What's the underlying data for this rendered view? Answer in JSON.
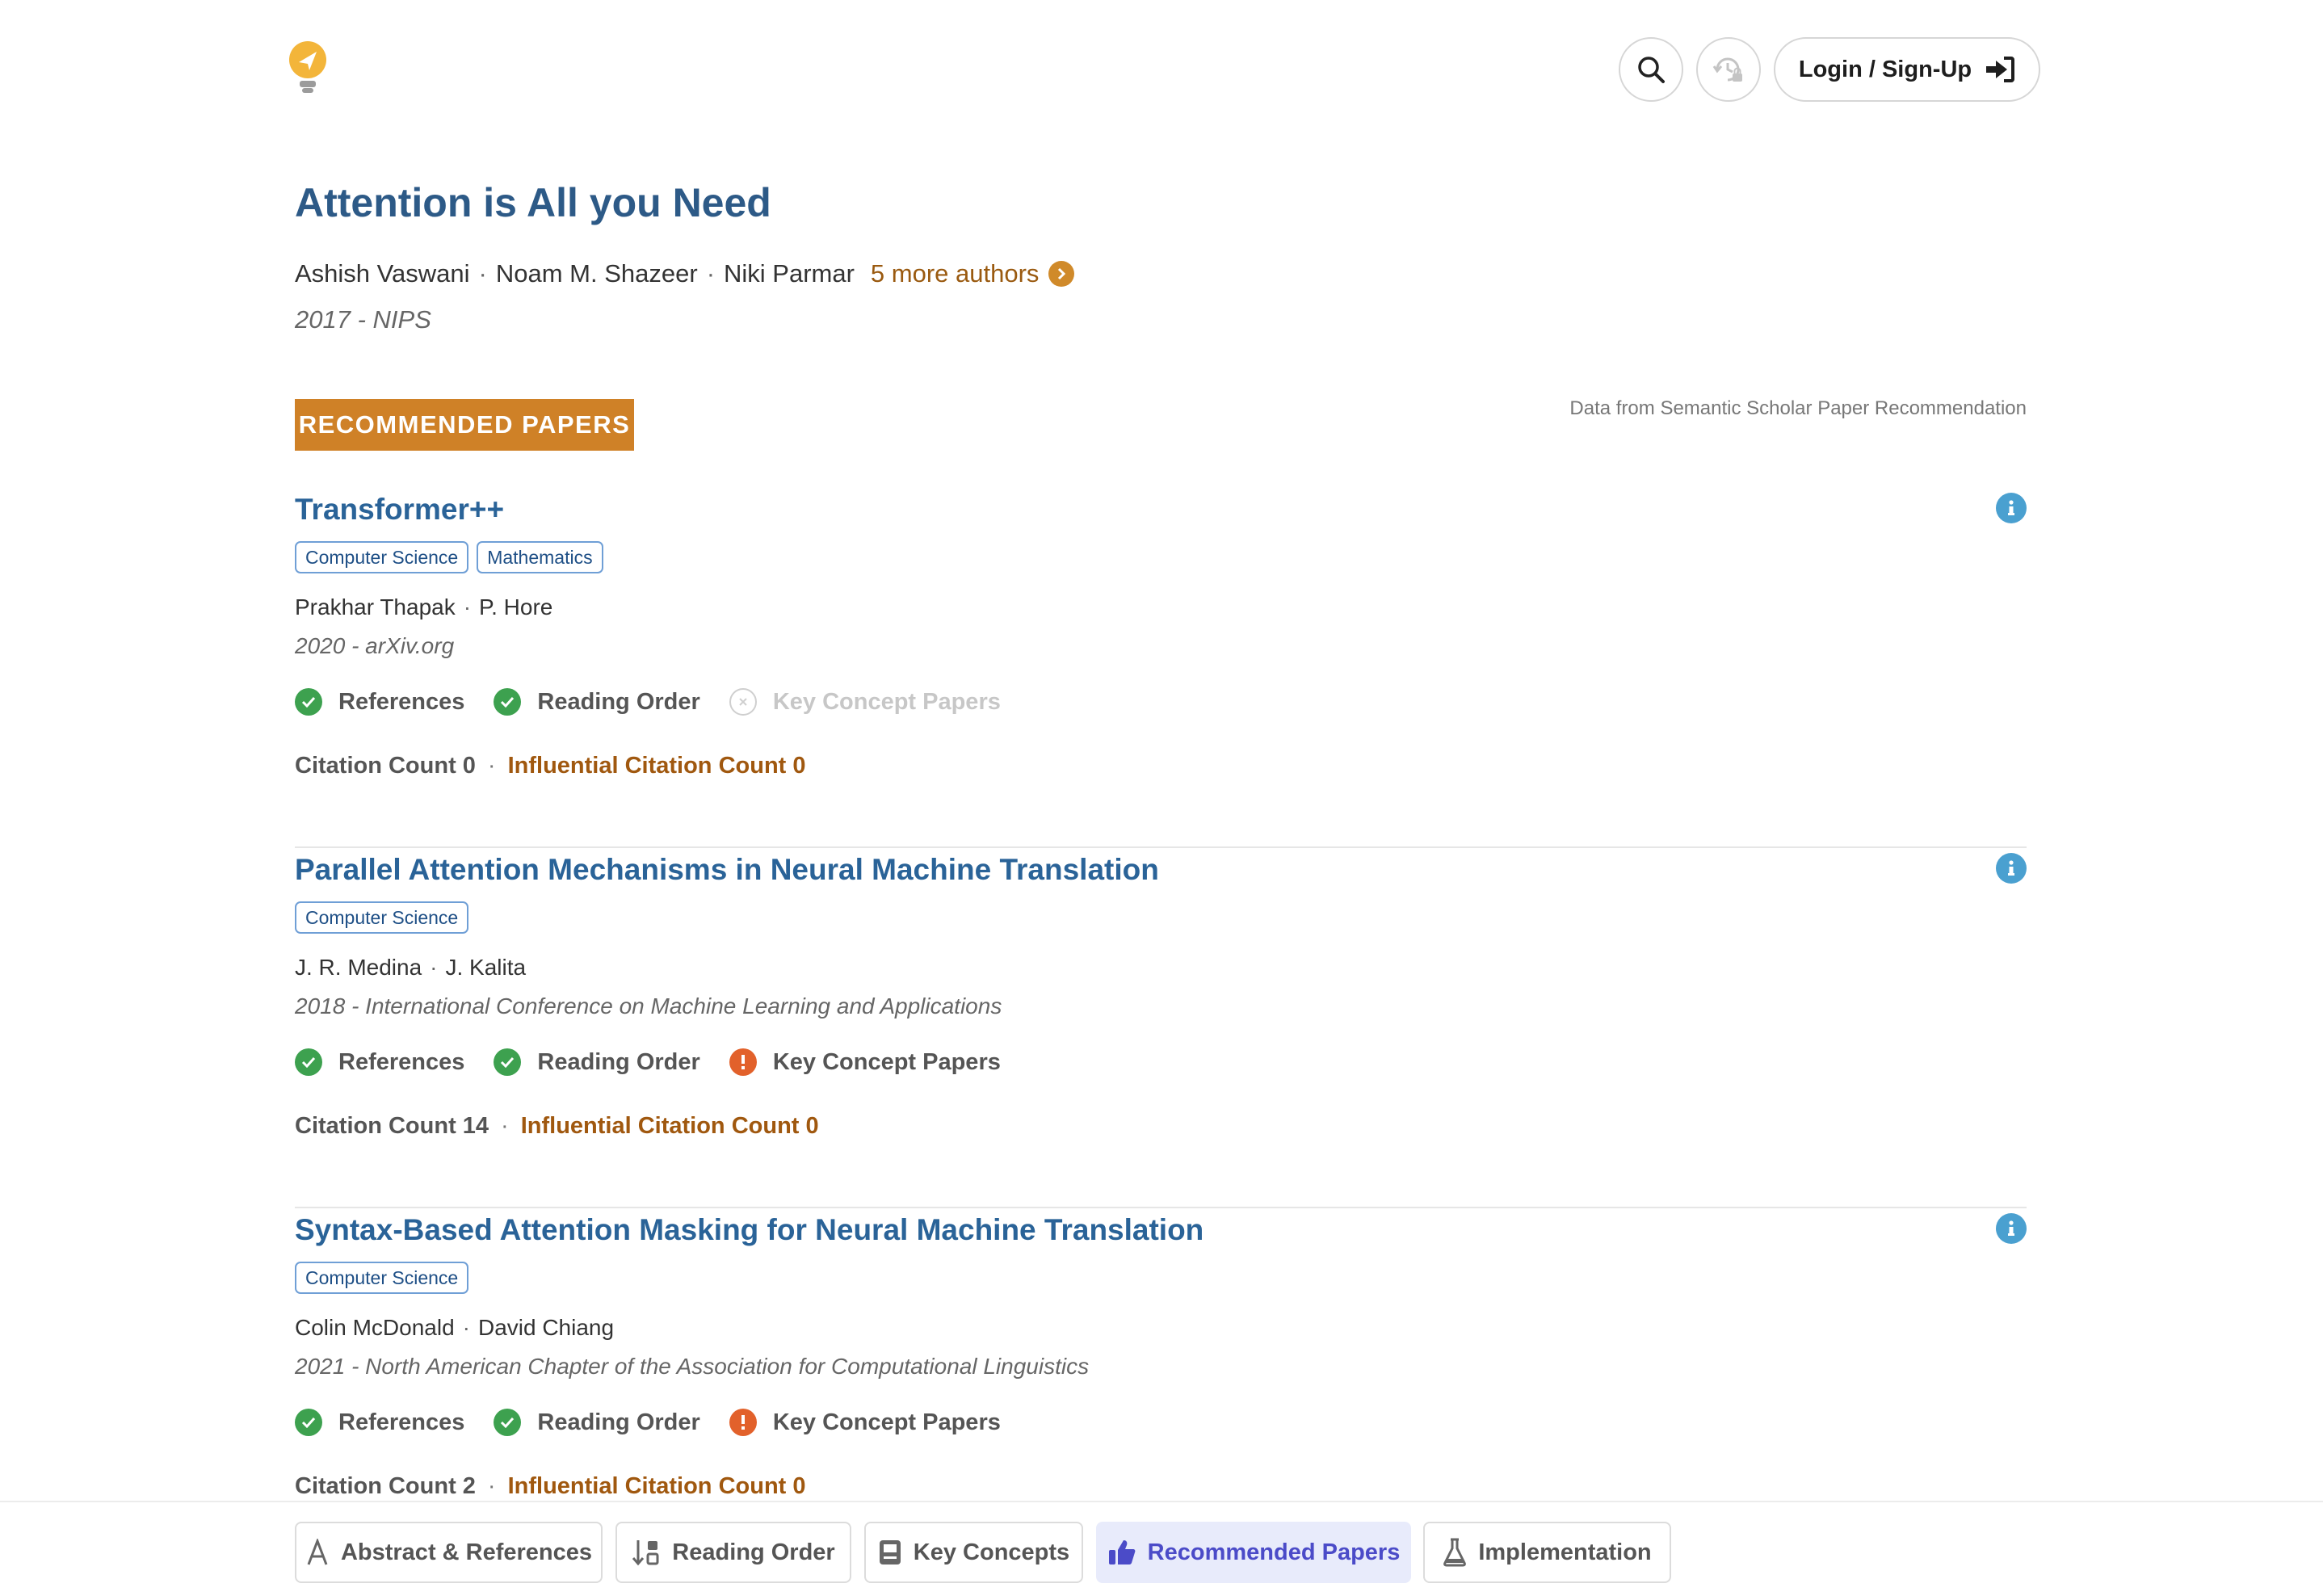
{
  "header": {
    "login_label": "Login / Sign-Up"
  },
  "paper": {
    "title": "Attention is All you Need",
    "authors": [
      "Ashish Vaswani",
      "Noam M. Shazeer",
      "Niki Parmar"
    ],
    "more_authors": "5 more authors",
    "year_venue": "2017 - NIPS"
  },
  "section": {
    "badge": "RECOMMENDED PAPERS",
    "source": "Data from Semantic Scholar Paper Recommendation"
  },
  "recommended": [
    {
      "title": "Transformer++",
      "tags": [
        "Computer Science",
        "Mathematics"
      ],
      "authors": [
        "Prakhar Thapak",
        "P. Hore"
      ],
      "year_venue": "2020 - arXiv.org",
      "features": [
        {
          "label": "References",
          "status": "ok"
        },
        {
          "label": "Reading Order",
          "status": "ok"
        },
        {
          "label": "Key Concept Papers",
          "status": "off"
        }
      ],
      "citation_count": "Citation Count 0",
      "influential_count": "Influential Citation Count 0"
    },
    {
      "title": "Parallel Attention Mechanisms in Neural Machine Translation",
      "tags": [
        "Computer Science"
      ],
      "authors": [
        "J. R. Medina",
        "J. Kalita"
      ],
      "year_venue": "2018 - International Conference on Machine Learning and Applications",
      "features": [
        {
          "label": "References",
          "status": "ok"
        },
        {
          "label": "Reading Order",
          "status": "ok"
        },
        {
          "label": "Key Concept Papers",
          "status": "warn"
        }
      ],
      "citation_count": "Citation Count 14",
      "influential_count": "Influential Citation Count 0"
    },
    {
      "title": "Syntax-Based Attention Masking for Neural Machine Translation",
      "tags": [
        "Computer Science"
      ],
      "authors": [
        "Colin McDonald",
        "David Chiang"
      ],
      "year_venue": "2021 - North American Chapter of the Association for Computational Linguistics",
      "features": [
        {
          "label": "References",
          "status": "ok"
        },
        {
          "label": "Reading Order",
          "status": "ok"
        },
        {
          "label": "Key Concept Papers",
          "status": "warn"
        }
      ],
      "citation_count": "Citation Count 2",
      "influential_count": "Influential Citation Count 0"
    }
  ],
  "bottom_nav": {
    "tabs": [
      {
        "label": "Abstract & References",
        "icon": "abstract-icon",
        "active": false
      },
      {
        "label": "Reading Order",
        "icon": "sort-icon",
        "active": false
      },
      {
        "label": "Key Concepts",
        "icon": "concepts-icon",
        "active": false
      },
      {
        "label": "Recommended Papers",
        "icon": "thumbs-up-icon",
        "active": true
      },
      {
        "label": "Implementation",
        "icon": "flask-icon",
        "active": false
      }
    ]
  },
  "colors": {
    "title": "#2d5a87",
    "accent": "#cf8127",
    "link": "#2a6398",
    "ok": "#3da14f",
    "warn": "#e2612b",
    "active_tab": "#4b4bc8"
  }
}
